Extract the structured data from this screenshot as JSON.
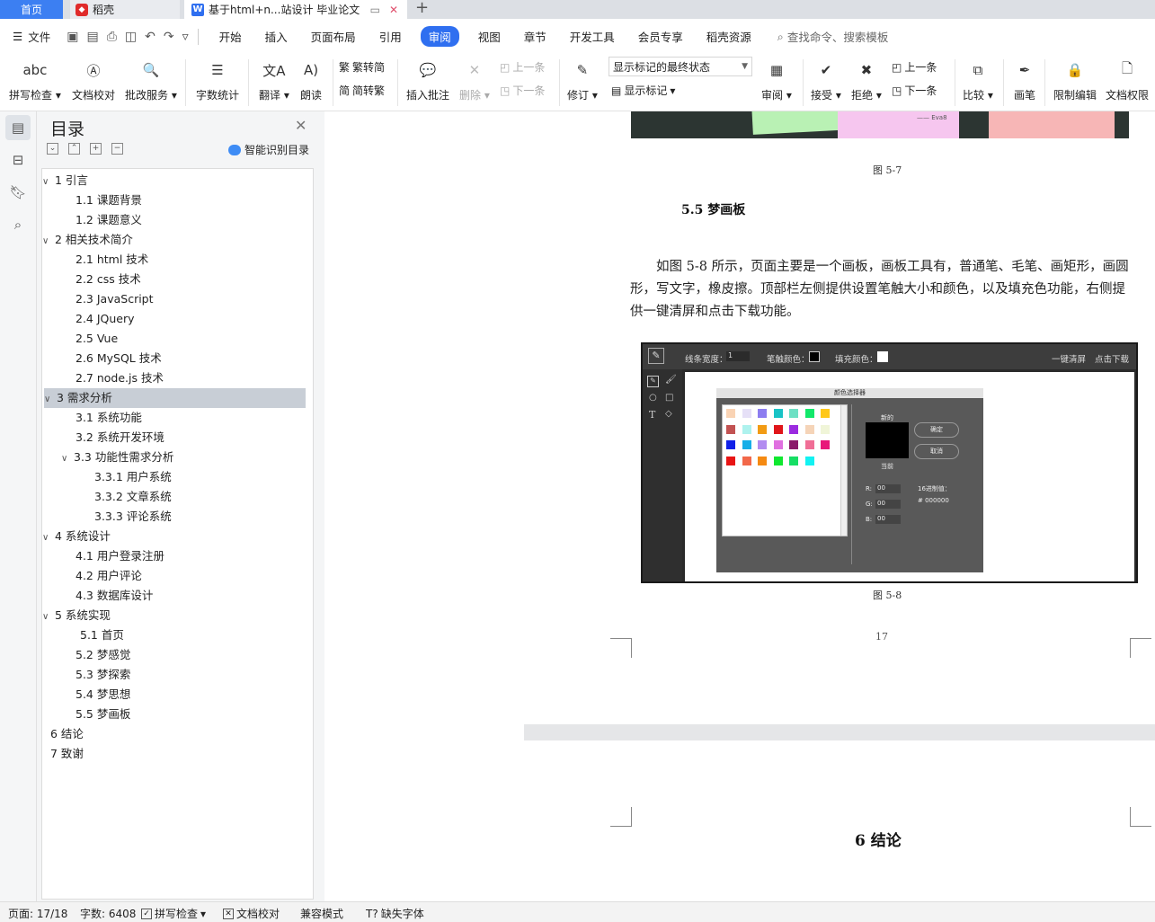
{
  "tabs": {
    "home": "首页",
    "daoke": "稻壳",
    "doc": "基于html+n...站设计 毕业论文",
    "add": "+"
  },
  "menu": {
    "file": "文件",
    "tabs": [
      "开始",
      "插入",
      "页面布局",
      "引用",
      "审阅",
      "视图",
      "章节",
      "开发工具",
      "会员专享",
      "稻壳资源"
    ],
    "active_tab": "审阅",
    "search": "查找命令、搜索模板"
  },
  "ribbon": {
    "spell": "拼写检查",
    "proof": "文档校对",
    "review_service": "批改服务",
    "word_count": "字数统计",
    "translate": "翻译",
    "read_aloud": "朗读",
    "to_traditional": "繁转简",
    "to_simplified": "简转繁",
    "insert_comment": "插入批注",
    "delete": "删除",
    "prev_comment": "上一条",
    "next_comment": "下一条",
    "revise": "修订",
    "markup_state": "显示标记的最终状态",
    "show_markup": "显示标记",
    "review": "审阅",
    "accept": "接受",
    "reject": "拒绝",
    "prev_change": "上一条",
    "next_change": "下一条",
    "compare": "比较",
    "pen": "画笔",
    "restrict_edit": "限制编辑",
    "doc_permission": "文档权限"
  },
  "toc": {
    "title": "目录",
    "smart": "智能识别目录",
    "items": [
      {
        "label": "1  引言",
        "level": 1,
        "caret": "v"
      },
      {
        "label": "1.1  课题背景",
        "level": 2
      },
      {
        "label": "1.2  课题意义",
        "level": 2
      },
      {
        "label": "2 相关技术简介",
        "level": 1,
        "caret": "v"
      },
      {
        "label": "2.1 html 技术",
        "level": 2
      },
      {
        "label": "2.2 css 技术",
        "level": 2
      },
      {
        "label": "2.3 JavaScript",
        "level": 2
      },
      {
        "label": "2.4 JQuery",
        "level": 2
      },
      {
        "label": "2.5 Vue",
        "level": 2
      },
      {
        "label": "2.6 MySQL 技术",
        "level": 2
      },
      {
        "label": "2.7 node.js 技术",
        "level": 2
      },
      {
        "label": "3 需求分析",
        "level": 1,
        "caret": "v",
        "selected": true
      },
      {
        "label": "3.1  系统功能",
        "level": 2
      },
      {
        "label": "3.2  系统开发环境",
        "level": 2
      },
      {
        "label": "3.3 功能性需求分析",
        "level": 2,
        "caret": "v"
      },
      {
        "label": "3.3.1 用户系统",
        "level": 3
      },
      {
        "label": "3.3.2  文章系统",
        "level": 3
      },
      {
        "label": "3.3.3    评论系统",
        "level": 3
      },
      {
        "label": "4  系统设计",
        "level": 1,
        "caret": "v"
      },
      {
        "label": "4.1  用户登录注册",
        "level": 2
      },
      {
        "label": "4.2  用户评论",
        "level": 2
      },
      {
        "label": "4.3  数据库设计",
        "level": 2
      },
      {
        "label": "5  系统实现",
        "level": 1,
        "caret": "v"
      },
      {
        "label": "5.1  首页",
        "level": 2,
        "extra_indent": true
      },
      {
        "label": "5.2  梦感觉",
        "level": 2
      },
      {
        "label": "5.3  梦探索",
        "level": 2
      },
      {
        "label": "5.4 梦思想",
        "level": 2
      },
      {
        "label": "5.5 梦画板",
        "level": 2
      },
      {
        "label": "6  结论",
        "level": 1
      },
      {
        "label": "7  致谢",
        "level": 1
      }
    ]
  },
  "doc": {
    "fig57_caption": "图 5-7",
    "fig57_sticky_text": "—— Eva8",
    "section_heading": "5.5 梦画板",
    "paragraph": "如图 5-8 所示，页面主要是一个画板，画板工具有，普通笔、毛笔、画矩形，画圆形，写文字，橡皮擦。顶部栏左侧提供设置笔触大小和颜色，以及填充色功能，右侧提供一键清屏和点击下载功能。",
    "fig58_caption": "图 5-8",
    "page_number": "17",
    "next_heading": "6  结论",
    "screenshot": {
      "line_width_label": "线条宽度：",
      "line_width_value": "1",
      "stroke_color_label": "笔触颜色：",
      "fill_color_label": "填充颜色：",
      "clear": "一键清屏",
      "download": "点击下载",
      "picker_title": "颜色选择器",
      "new_label": "新的",
      "current_label": "当前",
      "ok": "确定",
      "cancel": "取消",
      "r_label": "R:",
      "g_label": "G:",
      "b_label": "B:",
      "r_value": "00",
      "g_value": "00",
      "b_value": "00",
      "hex_label": "16进制值：",
      "hex_value": "#    000000",
      "swatches": [
        "#f9d3b4",
        "#e6e0f7",
        "#8c7df0",
        "#19c3c6",
        "#6de0c4",
        "#12e86a",
        "#ffc81a",
        "#c25252",
        "#aef2ee",
        "#f29b14",
        "#e0161a",
        "#9b2be0",
        "#f5d4b8",
        "#f0f5d8",
        "#1020e8",
        "#16aee8",
        "#b28cf0",
        "#e070e0",
        "#8a1a6a",
        "#f06e96",
        "#e8187a",
        "#e81414",
        "#f2684a",
        "#f58a12",
        "#10e830",
        "#16de64",
        "#12f2f2"
      ]
    }
  },
  "status": {
    "page": "页面: 17/18",
    "words": "字数: 6408",
    "spell": "拼写检查",
    "proof": "文档校对",
    "compat": "兼容模式",
    "missing_font": "缺失字体"
  }
}
